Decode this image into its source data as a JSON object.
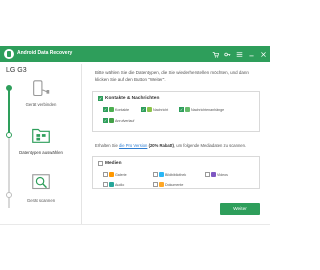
{
  "window": {
    "title": "Android Data Recovery"
  },
  "device": {
    "name": "LG G3"
  },
  "steps": [
    {
      "label": "Gerät verbinden"
    },
    {
      "label": "Datentypen auswählen"
    },
    {
      "label": "Gerät scannen"
    }
  ],
  "instruction": "Bitte wählen Sie die Datentypen, die Sie wiederherstellen möchten, und dann klicken Sie auf den Button \"Weiter\".",
  "contacts_group": {
    "title": "Kontakte & Nachrichten",
    "checked": true,
    "items": [
      {
        "label": "Kontakte",
        "checked": true,
        "icon": "contacts-icon",
        "color": "#4caf50"
      },
      {
        "label": "Nachricht",
        "checked": true,
        "icon": "message-icon",
        "color": "#8bc34a"
      },
      {
        "label": "Nachrichtenanhänge",
        "checked": true,
        "icon": "attachment-icon",
        "color": "#66bb6a"
      },
      {
        "label": "Anrufverlauf",
        "checked": true,
        "icon": "call-log-icon",
        "color": "#43a047"
      }
    ]
  },
  "promo": {
    "prefix": "Erhalten Sie",
    "link": "die Pro Version",
    "discount": "(20% Rabatt)",
    "suffix": ", um folgende Mediadaten zu scannen."
  },
  "media_group": {
    "title": "Medien",
    "checked": false,
    "items": [
      {
        "label": "Galerie",
        "checked": false,
        "icon": "gallery-icon",
        "color": "#ff9800"
      },
      {
        "label": "Bildbibliothek",
        "checked": false,
        "icon": "picture-library-icon",
        "color": "#29b6f6"
      },
      {
        "label": "Videos",
        "checked": false,
        "icon": "video-icon",
        "color": "#7e57c2"
      },
      {
        "label": "Audio",
        "checked": false,
        "icon": "audio-icon",
        "color": "#26a69a"
      },
      {
        "label": "Dokumente",
        "checked": false,
        "icon": "documents-icon",
        "color": "#ffa726"
      }
    ]
  },
  "buttons": {
    "next_label": "Weiter"
  },
  "colors": {
    "accent": "#2e9e5b",
    "link": "#2e7dd1"
  }
}
